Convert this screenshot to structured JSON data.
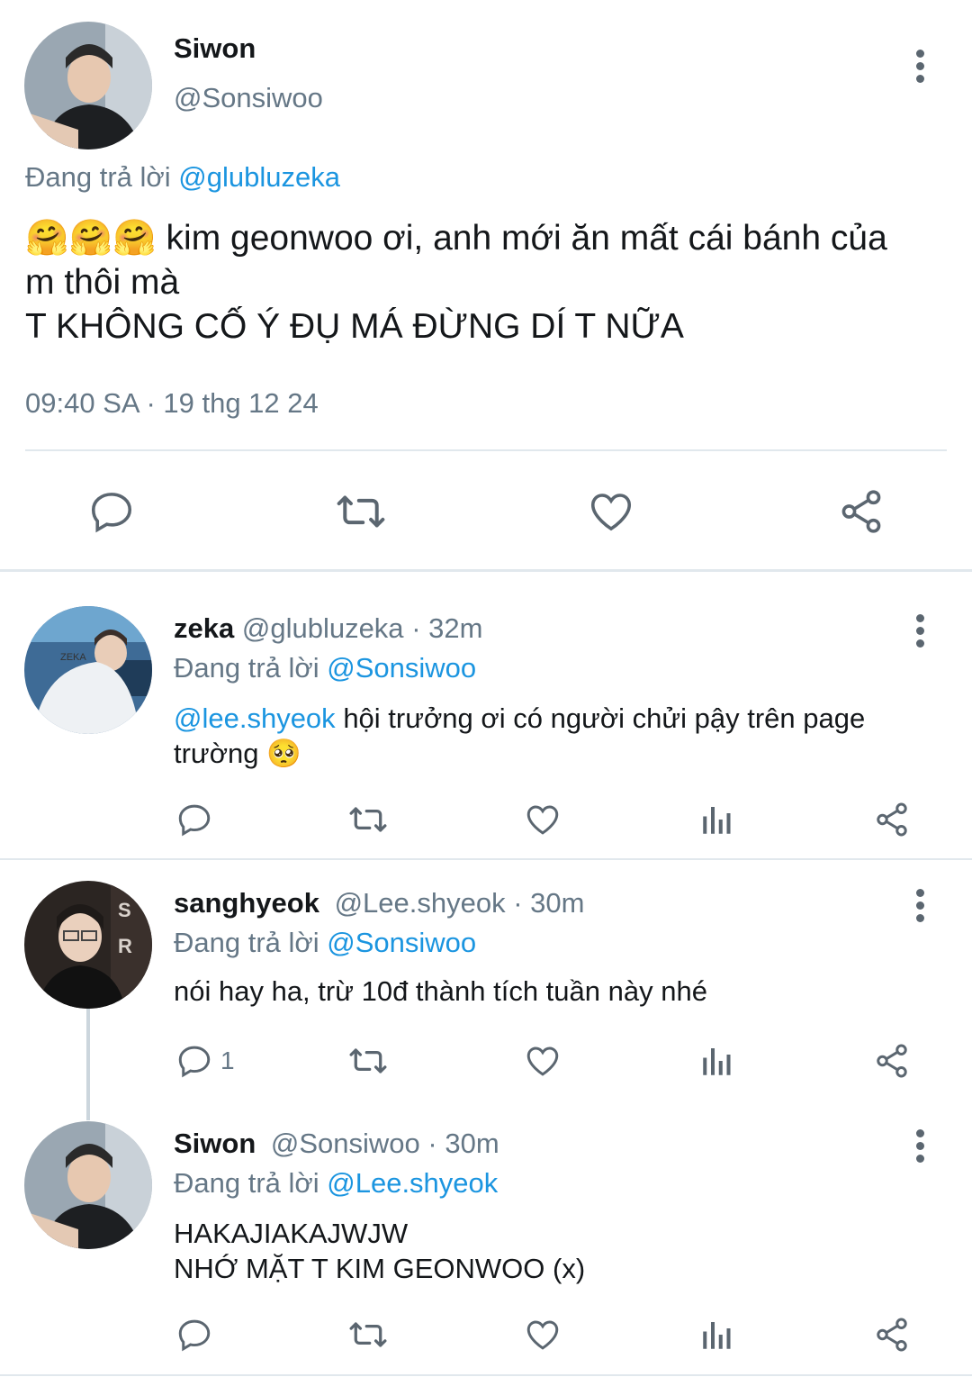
{
  "main_tweet": {
    "display_name": "Siwon",
    "handle": "@Sonsiwoo",
    "reply_prefix": "Đang trả lời",
    "reply_to": "@glubluzeka",
    "emojis": "🤗🤗🤗",
    "text_line1": "kim geonwoo ơi, anh mới ăn mất cái bánh của",
    "text_line2": "m thôi mà",
    "text_line3": "T KHÔNG CỐ Ý ĐỤ MÁ ĐỪNG DÍ T NỮA",
    "timestamp": "09:40 SA · 19 thg 12 24",
    "actions": [
      "reply-icon",
      "retweet-icon",
      "like-icon",
      "share-icon"
    ]
  },
  "replies": [
    {
      "display_name": "zeka",
      "handle": "@glubluzeka",
      "time": "· 32m",
      "reply_prefix": "Đang trả lời",
      "reply_to": "@Sonsiwoo",
      "mention": "@lee.shyeok",
      "text_line1": "hội trưởng ơi có người chửi pậy trên page",
      "text_line2": "trường 🥺",
      "reply_count": ""
    },
    {
      "display_name": "sanghyeok",
      "handle": "@Lee.shyeok",
      "time": "· 30m",
      "reply_prefix": "Đang trả lời",
      "reply_to": "@Sonsiwoo",
      "text_line1": "nói hay ha, trừ 10đ thành tích tuần này nhé",
      "reply_count": "1"
    },
    {
      "display_name": "Siwon",
      "handle": "@Sonsiwoo",
      "time": "· 30m",
      "reply_prefix": "Đang trả lời",
      "reply_to": "@Lee.shyeok",
      "text_line1": "HAKAJIAKAJWJW",
      "text_line2": "NHỚ MẶT T KIM GEONWOO (x)",
      "reply_count": ""
    }
  ],
  "colors": {
    "link": "#1b95e0",
    "muted": "#657786",
    "icon": "#5b6670",
    "divider": "#e1e8ed"
  }
}
